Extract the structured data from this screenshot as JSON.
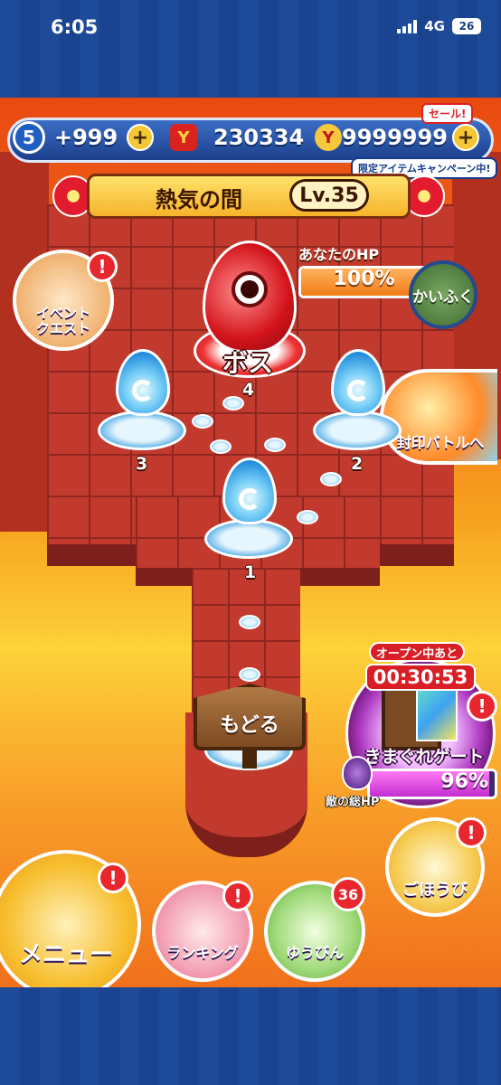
{
  "status_bar": {
    "time": "6:05",
    "network": "4G",
    "battery": "26"
  },
  "hud": {
    "stamina_level": "5",
    "stamina_value": "+999",
    "coins_value": "230334",
    "gems_value": "9999999",
    "sale_label": "セール!",
    "campaign_label": "限定アイテムキャンペーン中!"
  },
  "stage": {
    "title": "熱気の間",
    "level": "Lv.35"
  },
  "player_hp": {
    "label": "あなたのHP",
    "percent": 100,
    "percent_text": "100%",
    "recover_label": "かいふく"
  },
  "boss_node": {
    "label": "ボス",
    "number": "4"
  },
  "nodes": [
    {
      "number": "1"
    },
    {
      "number": "2"
    },
    {
      "number": "3"
    }
  ],
  "event_quest": {
    "label_line1": "イベント",
    "label_line2": "クエスト"
  },
  "seal_battle": {
    "label": "封印バトルへ"
  },
  "back_button": {
    "label": "もどる"
  },
  "gate": {
    "open_label": "オープン中あと",
    "timer": "00:30:53",
    "label": "きまぐれゲート",
    "enemy_hp_label": "敵の総HP",
    "enemy_hp_percent": 96,
    "enemy_hp_text": "96%"
  },
  "reward_button": {
    "label": "ごほうび"
  },
  "bottom_nav": {
    "menu_label": "メニュー",
    "ranking_label": "ランキング",
    "mail_label": "ゆうびん",
    "mail_badge": "36"
  },
  "badges": {
    "alert": "!"
  },
  "colors": {
    "accent_blue": "#1d4a99",
    "badge_red": "#e8262d",
    "hp_orange": "#f07c17",
    "gate_purple": "#c22fd0"
  }
}
